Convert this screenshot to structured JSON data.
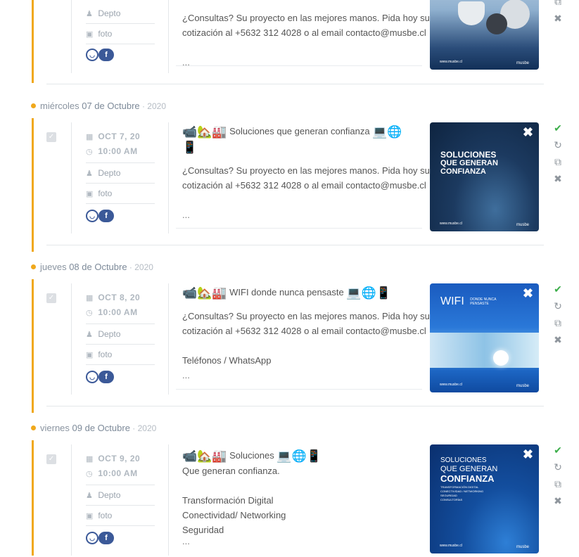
{
  "colors": {
    "timeline": "#f0a81c",
    "check_ok": "#3cae4a",
    "social": "#3b5998"
  },
  "network_icons": [
    "messenger-icon",
    "facebook-icon",
    "flag-icon"
  ],
  "day_headers": [
    {
      "dname": "miércoles",
      "rest": " 07 de Octubre",
      "sep": " · ",
      "year": "2020"
    },
    {
      "dname": "jueves",
      "rest": " 08 de Octubre",
      "sep": " · ",
      "year": "2020"
    },
    {
      "dname": "viernes",
      "rest": " 09 de Octubre",
      "sep": " · ",
      "year": "2020"
    }
  ],
  "top_post": {
    "depto": "Depto",
    "foto": "foto",
    "text_1": "¿Consultas? Su proyecto en las mejores manos. Pida hoy su",
    "text_2": "cotización al +5632 312 4028 o al email contacto@musbe.cl",
    "more": "...",
    "thumb_brand": "musbe",
    "thumb_url": "www.musbe.cl"
  },
  "posts": [
    {
      "date": "OCT 7, 20",
      "time": "10:00 AM",
      "depto": "Depto",
      "foto": "foto",
      "headline": "Soluciones que generan confianza",
      "body_1": "¿Consultas? Su proyecto en las mejores manos. Pida hoy su",
      "body_2": "cotización al +5632 312 4028 o al email contacto@musbe.cl",
      "more": "...",
      "thumb_title": [
        "SOLUCIONES",
        "QUE GENERAN",
        "CONFIANZA"
      ],
      "thumb_url": "www.musbe.cl",
      "thumb_brand": "musbe"
    },
    {
      "date": "OCT 8, 20",
      "time": "10:00 AM",
      "depto": "Depto",
      "foto": "foto",
      "headline": "WIFI donde nunca pensaste",
      "body_1": "¿Consultas? Su proyecto en las mejores manos. Pida hoy su",
      "body_2": "cotización al +5632 312 4028 o al email contacto@musbe.cl",
      "body_3": "Teléfonos / WhatsApp",
      "more": "...",
      "thumb_title": [
        "WIFI",
        "DONDE NUNCA",
        "PENSASTE"
      ],
      "thumb_url": "www.musbe.cl",
      "thumb_brand": "musbe"
    },
    {
      "date": "OCT 9, 20",
      "time": "10:00 AM",
      "depto": "Depto",
      "foto": "foto",
      "headline": "Soluciones",
      "body_1": "Que generan confianza.",
      "list": [
        "Transformación Digital",
        "Conectividad/ Networking",
        "Seguridad"
      ],
      "more": "...",
      "thumb_title": [
        "SOLUCIONES",
        "QUE GENERAN",
        "CONFIANZA"
      ],
      "thumb_sub": [
        "TRANSFORMACIÓN DIGITAL",
        "CONECTIVIDAD / NETWORKING",
        "SEGURIDAD",
        "CONSULTORÍAS"
      ],
      "thumb_url": "www.musbe.cl",
      "thumb_brand": "musbe"
    }
  ]
}
